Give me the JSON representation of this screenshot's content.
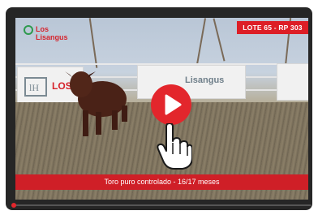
{
  "video": {
    "lot_badge": "LOTE 65 - RP 303",
    "caption": "Toro puro controlado - 16/17 meses",
    "top_left_logo_text": "Los Lisangus",
    "banner_left_text": "LOS",
    "banner_center_text": "Lisangus"
  },
  "controls": {
    "progress_fraction": 0.0
  },
  "colors": {
    "accent_red": "#dd1e26",
    "player_frame": "#262626"
  },
  "icons": {
    "play": "play-icon",
    "cursor": "hand-pointer-icon",
    "logo": "ranch-logo-icon"
  }
}
